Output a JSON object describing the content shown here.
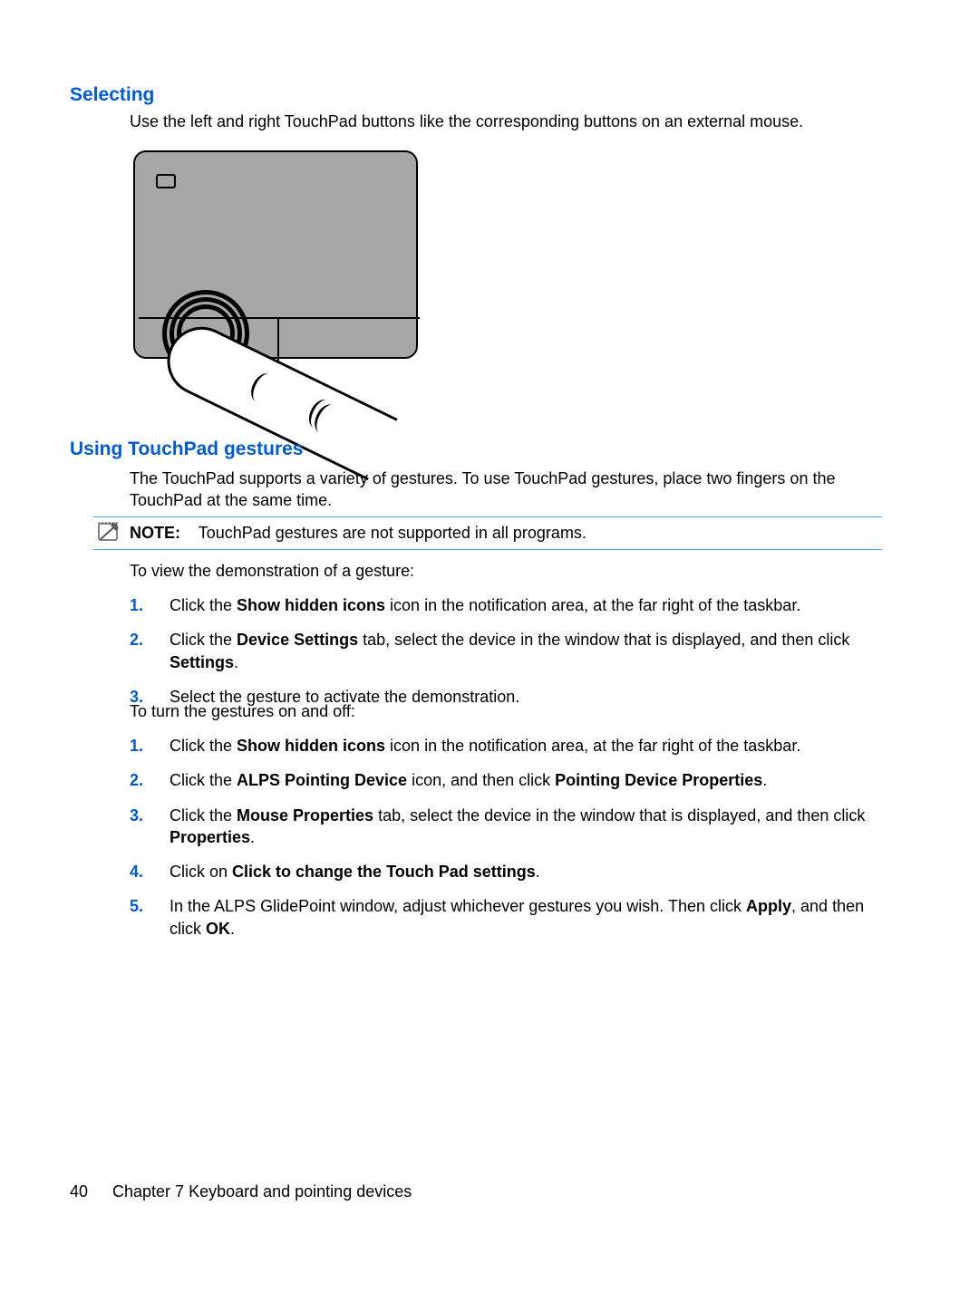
{
  "headings": {
    "selecting": "Selecting",
    "gestures": "Using TouchPad gestures"
  },
  "selecting_intro": "Use the left and right TouchPad buttons like the corresponding buttons on an external mouse.",
  "gestures_intro": "The TouchPad supports a variety of gestures. To use TouchPad gestures, place two fingers on the TouchPad at the same time.",
  "note": {
    "label": "NOTE:",
    "text": "TouchPad gestures are not supported in all programs."
  },
  "view_demo_intro": "To view the demonstration of a gesture:",
  "steps_view": {
    "s1_a": "Click the ",
    "s1_b": "Show hidden icons",
    "s1_c": " icon in the notification area, at the far right of the taskbar.",
    "s2_a": "Click the ",
    "s2_b": "Device Settings",
    "s2_c": " tab, select the device in the window that is displayed, and then click ",
    "s2_d": "Settings",
    "s2_e": ".",
    "s3": "Select the gesture to activate the demonstration."
  },
  "turn_on_off_intro": "To turn the gestures on and off:",
  "steps_toggle": {
    "s1_a": "Click the ",
    "s1_b": "Show hidden icons",
    "s1_c": " icon in the notification area, at the far right of the taskbar.",
    "s2_a": "Click the ",
    "s2_b": "ALPS Pointing Device",
    "s2_c": " icon, and then click ",
    "s2_d": "Pointing Device Properties",
    "s2_e": ".",
    "s3_a": "Click the ",
    "s3_b": "Mouse Properties",
    "s3_c": " tab, select the device in the window that is displayed, and then click ",
    "s3_d": "Properties",
    "s3_e": ".",
    "s4_a": "Click on ",
    "s4_b": "Click to change the Touch Pad settings",
    "s4_c": ".",
    "s5_a": "In the ALPS GlidePoint window, adjust whichever gestures you wish. Then click ",
    "s5_b": "Apply",
    "s5_c": ", and then click ",
    "s5_d": "OK",
    "s5_e": "."
  },
  "nums": {
    "n1": "1.",
    "n2": "2.",
    "n3": "3.",
    "n4": "4.",
    "n5": "5."
  },
  "footer": {
    "page": "40",
    "chapter": "Chapter 7   Keyboard and pointing devices"
  }
}
